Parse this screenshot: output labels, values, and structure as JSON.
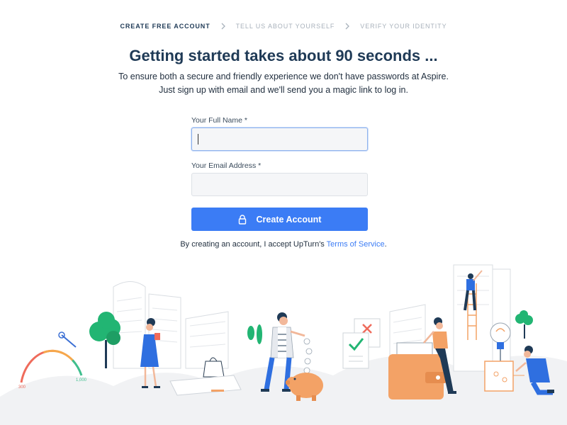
{
  "steps": [
    {
      "label": "CREATE FREE ACCOUNT"
    },
    {
      "label": "TELL US ABOUT YOURSELF"
    },
    {
      "label": "VERIFY YOUR IDENTITY"
    }
  ],
  "header": {
    "title": "Getting started takes about 90 seconds ...",
    "subtitle_line1": "To ensure both a secure and friendly experience we don't have passwords at Aspire.",
    "subtitle_line2": "Just sign up with email and we'll send you a magic link to log in."
  },
  "form": {
    "name_label": "Your Full Name *",
    "name_value": "",
    "email_label": "Your Email Address *",
    "email_value": "",
    "submit_label": "Create Account"
  },
  "terms": {
    "prefix": "By creating an account, I accept UpTurn's ",
    "link": "Terms of Service",
    "suffix": "."
  },
  "illustration": {
    "gauge_min": "300",
    "gauge_max": "1,000"
  },
  "colors": {
    "accent": "#3b7cf5",
    "navy": "#1f3a56",
    "orange": "#f3a266",
    "green": "#22b573"
  },
  "icons": [
    "chevron-right-icon",
    "lock-icon"
  ]
}
